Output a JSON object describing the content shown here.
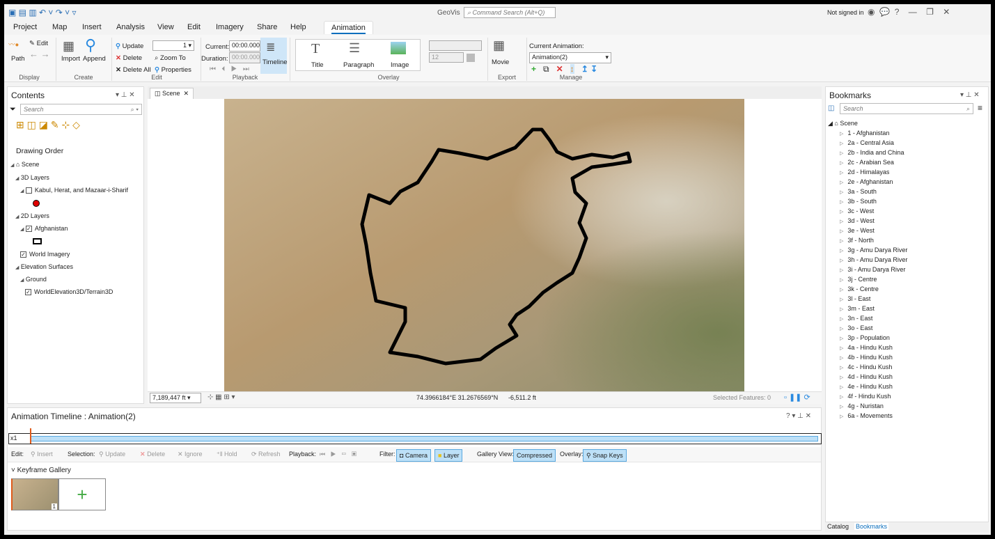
{
  "app": {
    "title": "GeoVis",
    "command_search": "Command Search (Alt+Q)",
    "signed_in": "Not signed in"
  },
  "tabs": [
    "Project",
    "Map",
    "Insert",
    "Analysis",
    "View",
    "Edit",
    "Imagery",
    "Share",
    "Help",
    "Animation"
  ],
  "ribbon": {
    "display": {
      "path": "Path",
      "edit": "Edit",
      "label": "Display"
    },
    "create": {
      "import": "Import",
      "append": "Append",
      "label": "Create"
    },
    "edit": {
      "update": "Update",
      "delete": "Delete",
      "delete_all": "Delete All",
      "keyframe_value": "1",
      "zoom_to": "Zoom To",
      "properties": "Properties",
      "label": "Edit"
    },
    "playback": {
      "current_label": "Current:",
      "current": "00:00.000",
      "duration_label": "Duration:",
      "duration": "00:00.000",
      "timeline": "Timeline",
      "label": "Playback"
    },
    "overlay": {
      "title": "Title",
      "paragraph": "Paragraph",
      "image": "Image",
      "font_size": "12",
      "label": "Overlay"
    },
    "export": {
      "movie": "Movie",
      "label": "Export"
    },
    "manage": {
      "current_label": "Current Animation:",
      "current": "Animation(2)",
      "label": "Manage"
    }
  },
  "contents": {
    "title": "Contents",
    "search_placeholder": "Search",
    "drawing_order": "Drawing Order",
    "tree": [
      {
        "label": "Scene",
        "level": 0,
        "type": "scene"
      },
      {
        "label": "3D Layers",
        "level": 1,
        "type": "group"
      },
      {
        "label": "Kabul, Herat, and Mazaar-i-Sharif",
        "level": 2,
        "type": "layer",
        "checked": false
      },
      {
        "label": "2D Layers",
        "level": 1,
        "type": "group"
      },
      {
        "label": "Afghanistan",
        "level": 2,
        "type": "layer",
        "checked": true
      },
      {
        "label": "World Imagery",
        "level": 2,
        "type": "layer",
        "checked": true
      },
      {
        "label": "Elevation Surfaces",
        "level": 1,
        "type": "group"
      },
      {
        "label": "Ground",
        "level": 2,
        "type": "group"
      },
      {
        "label": "WorldElevation3D/Terrain3D",
        "level": 3,
        "type": "layer",
        "checked": true
      }
    ]
  },
  "scene": {
    "tab": "Scene",
    "scale": "7,189,447 ft",
    "coords": "74.3966184°E 31.2676569°N",
    "elevation": "-6,511.2 ft",
    "selected": "Selected Features: 0"
  },
  "timeline": {
    "title": "Animation Timeline : Animation(2)",
    "speed": "x1",
    "toolbar": {
      "edit": "Edit:",
      "insert": "Insert",
      "selection": "Selection:",
      "update": "Update",
      "delete": "Delete",
      "ignore": "Ignore",
      "hold": "Hold",
      "refresh": "Refresh",
      "playback": "Playback:",
      "filter": "Filter:",
      "camera": "Camera",
      "layer": "Layer",
      "gallery_view": "Gallery View:",
      "compressed": "Compressed",
      "overlay": "Overlay:",
      "snap_keys": "Snap Keys"
    },
    "gallery_title": "Keyframe Gallery",
    "keyframe_number": "1"
  },
  "bookmarks": {
    "title": "Bookmarks",
    "search_placeholder": "Search",
    "root": "Scene",
    "items": [
      "1 - Afghanistan",
      "2a - Central Asia",
      "2b - India and China",
      "2c - Arabian Sea",
      "2d - Himalayas",
      "2e - Afghanistan",
      "3a - South",
      "3b - South",
      "3c - West",
      "3d - West",
      "3e - West",
      "3f - North",
      "3g - Amu Darya River",
      "3h - Amu Darya River",
      "3i - Amu Darya River",
      "3j - Centre",
      "3k - Centre",
      "3l - East",
      "3m - East",
      "3n - East",
      "3o - East",
      "3p - Population",
      "4a - Hindu Kush",
      "4b - Hindu Kush",
      "4c - Hindu Kush",
      "4d - Hindu Kush",
      "4e - Hindu Kush",
      "4f - Hindu Kush",
      "4g - Nuristan",
      "6a - Movements"
    ],
    "bottom_tabs": [
      "Catalog",
      "Bookmarks"
    ]
  },
  "colors": {
    "accent": "#0a6ebd",
    "highlight": "#bde0f7",
    "boundary": "#000000",
    "point": "#e00000"
  }
}
